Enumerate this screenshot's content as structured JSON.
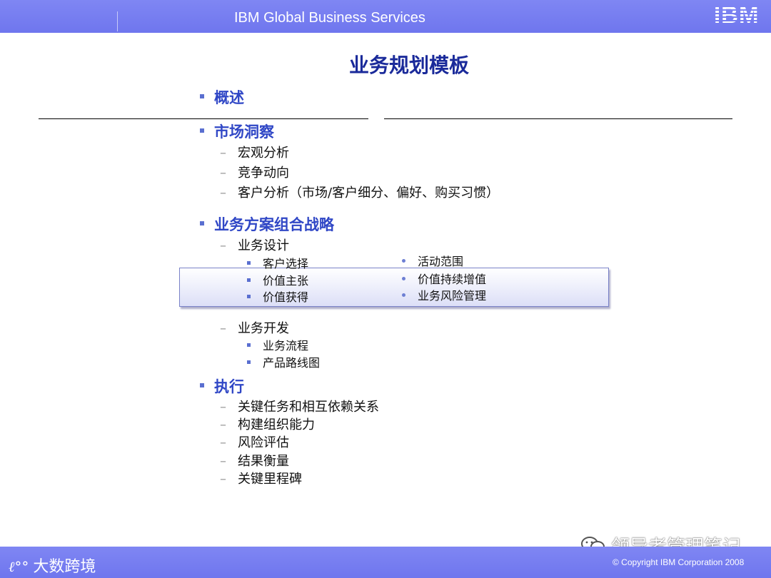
{
  "header": {
    "title": "IBM Global Business Services",
    "logo": "IBM"
  },
  "page_title": "业务规划模板",
  "outline": {
    "overview": "概述",
    "market": {
      "label": "市场洞察",
      "items": [
        "宏观分析",
        "竞争动向",
        "客户分析（市场/客户细分、偏好、购买习惯）"
      ]
    },
    "strategy": {
      "label": "业务方案组合战略",
      "design": {
        "label": "业务设计",
        "left_items": [
          "客户选择",
          "价值主张",
          "价值获得"
        ],
        "right_items": [
          "活动范围",
          "价值持续增值",
          "业务风险管理"
        ]
      },
      "dev": {
        "label": "业务开发",
        "items": [
          "业务流程",
          "产品路线图"
        ]
      }
    },
    "execute": {
      "label": "执行",
      "items": [
        "关键任务和相互依赖关系",
        "构建组织能力",
        "风险评估",
        "结果衡量",
        "关键里程碑"
      ]
    }
  },
  "dash": "–",
  "footer": {
    "brand_logo": "ℓ°°",
    "brand_text": "大数跨境",
    "watermark": "领导者管理笔记",
    "copyright": "© Copyright IBM Corporation 2008"
  },
  "colors": {
    "banner": "#767cf0",
    "title": "#1a2a9a",
    "heading": "#3047c6",
    "bullet": "#5a6fd0"
  }
}
